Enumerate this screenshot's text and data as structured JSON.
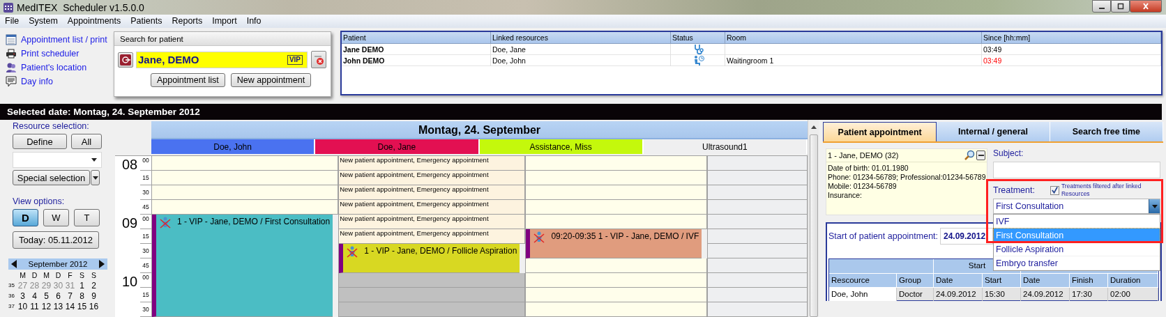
{
  "window": {
    "title": "MedITEX  Scheduler v1.5.0.0"
  },
  "menu": [
    "File",
    "System",
    "Appointments",
    "Patients",
    "Reports",
    "Import",
    "Info"
  ],
  "quick_links": [
    {
      "kind": "list",
      "label": "Appointment list / print"
    },
    {
      "kind": "print",
      "label": "Print scheduler"
    },
    {
      "kind": "location",
      "label": "Patient's location"
    },
    {
      "kind": "info",
      "label": "Day info"
    }
  ],
  "patient_search": {
    "title": "Search for patient",
    "value": "Jane, DEMO",
    "badge": "VIP",
    "buttons": [
      "Appointment list",
      "New appointment"
    ]
  },
  "patients_table": {
    "columns": [
      "Patient",
      "Linked resources",
      "Status",
      "Room",
      "Since [hh:mm]"
    ],
    "rows": [
      {
        "patient": "Jane DEMO",
        "linked_resources": "Doe, Jane",
        "kind": "treatment",
        "since": "03:49",
        "late": false
      },
      {
        "patient": "John DEMO",
        "linked_resources": "Doe, John",
        "kind": "waiting",
        "room": "Waitingroom 1",
        "since": "03:49",
        "late": true
      }
    ]
  },
  "selected_date": "Selected date: Montag, 24. September 2012",
  "sidebar": {
    "resource_label": "Resource selection:",
    "define": "Define",
    "all": "All",
    "special": "Special selection",
    "view_label": "View options:",
    "views": [
      {
        "label": "D",
        "selected": true
      },
      {
        "label": "W",
        "selected": false
      },
      {
        "label": "T",
        "selected": false
      }
    ],
    "today": "Today: 05.11.2012"
  },
  "mini_calendar": {
    "month": "September 2012",
    "weekdays": [
      "M",
      "D",
      "M",
      "D",
      "F",
      "S",
      "S"
    ],
    "weeks": [
      {
        "number": "35",
        "days": [
          {
            "day": "27",
            "other_month": true
          },
          {
            "day": "28",
            "other_month": true
          },
          {
            "day": "29",
            "other_month": true
          },
          {
            "day": "30",
            "other_month": true
          },
          {
            "day": "31",
            "other_month": true
          },
          {
            "day": "1",
            "other_month": false
          },
          {
            "day": "2",
            "other_month": false
          }
        ]
      },
      {
        "number": "36",
        "days": [
          {
            "day": "3",
            "other_month": false
          },
          {
            "day": "4",
            "other_month": false
          },
          {
            "day": "5",
            "other_month": false
          },
          {
            "day": "6",
            "other_month": false
          },
          {
            "day": "7",
            "other_month": false
          },
          {
            "day": "8",
            "other_month": false
          },
          {
            "day": "9",
            "other_month": false
          }
        ]
      },
      {
        "number": "37",
        "days": [
          {
            "day": "10",
            "other_month": false
          },
          {
            "day": "11",
            "other_month": false
          },
          {
            "day": "12",
            "other_month": false
          },
          {
            "day": "13",
            "other_month": false
          },
          {
            "day": "14",
            "other_month": false
          },
          {
            "day": "15",
            "other_month": false
          },
          {
            "day": "16",
            "other_month": false
          }
        ]
      }
    ]
  },
  "schedule": {
    "day": "Montag, 24. September",
    "times": [
      {
        "hour": "08",
        "minute": "00"
      },
      {
        "minute": "15"
      },
      {
        "minute": "30"
      },
      {
        "minute": "45"
      },
      {
        "hour": "09",
        "minute": "00"
      },
      {
        "minute": "15"
      },
      {
        "minute": "30"
      },
      {
        "minute": "45"
      },
      {
        "hour": "10",
        "minute": "00"
      },
      {
        "minute": "15"
      },
      {
        "minute": "30"
      }
    ],
    "resources": [
      {
        "name": "Doe, John",
        "color": "#4a72f0",
        "slots": [
          {
            "kind": "free"
          },
          {
            "kind": "free"
          },
          {
            "kind": "free"
          },
          {
            "kind": "free"
          },
          {
            "kind": "appointment",
            "text": "1 - VIP - Jane, DEMO / First Consultation",
            "color": "#4bbdc4"
          },
          {
            "kind": "continued"
          },
          {
            "kind": "continued"
          },
          {
            "kind": "continued"
          },
          {
            "kind": "continued"
          },
          {
            "kind": "continued"
          },
          {
            "kind": "continued"
          }
        ]
      },
      {
        "name": "Doe, Jane",
        "color": "#e31052",
        "slots": [
          {
            "kind": "note",
            "text": "New patient appointment, Emergency appointment"
          },
          {
            "kind": "note",
            "text": "New patient appointment, Emergency appointment"
          },
          {
            "kind": "note",
            "text": "New patient appointment, Emergency appointment"
          },
          {
            "kind": "note",
            "text": "New patient appointment, Emergency appointment"
          },
          {
            "kind": "note",
            "text": "New patient appointment, Emergency appointment"
          },
          {
            "kind": "note",
            "text": "New patient appointment, Emergency appointment"
          },
          {
            "kind": "appointment",
            "text": "1 - VIP - Jane, DEMO / Follicle Aspiration",
            "color": "#d8d822"
          },
          {
            "kind": "continued"
          },
          {
            "kind": "blocked"
          },
          {
            "kind": "blocked"
          },
          {
            "kind": "blocked"
          }
        ]
      },
      {
        "name": "Assistance, Miss",
        "color": "#c4f80c",
        "slots": [
          {
            "kind": "free"
          },
          {
            "kind": "free"
          },
          {
            "kind": "free"
          },
          {
            "kind": "free"
          },
          {
            "kind": "free"
          },
          {
            "kind": "appointment",
            "text": "09:20-09:35 1 - VIP - Jane, DEMO / IVF",
            "color": "#e09c7e"
          },
          {
            "kind": "continued"
          },
          {
            "kind": "free"
          },
          {
            "kind": "free"
          },
          {
            "kind": "free"
          },
          {
            "kind": "free"
          }
        ]
      },
      {
        "name": "Ultrasound1",
        "color": "#efeff0",
        "slots": [
          {
            "kind": "inactive"
          },
          {
            "kind": "inactive"
          },
          {
            "kind": "inactive"
          },
          {
            "kind": "inactive"
          },
          {
            "kind": "inactive"
          },
          {
            "kind": "inactive"
          },
          {
            "kind": "inactive"
          },
          {
            "kind": "inactive"
          },
          {
            "kind": "inactive"
          },
          {
            "kind": "inactive"
          },
          {
            "kind": "inactive"
          }
        ]
      }
    ]
  },
  "appointment_panel": {
    "tabs": [
      {
        "label": "Patient appointment",
        "selected": true
      },
      {
        "label": "Internal / general",
        "selected": false
      },
      {
        "label": "Search free time",
        "selected": false
      }
    ],
    "patient": {
      "name": "1 - Jane, DEMO (32)",
      "details": [
        "Date of birth: 01.01.1980",
        "Phone: 01234-56789; Professional:01234-56789",
        "Mobile: 01234-56789",
        "Insurance:"
      ]
    },
    "subject": {
      "label": "Subject:"
    },
    "treatment": {
      "label": "Treatment:",
      "highlighted": true,
      "filter": {
        "label": "Treatments filtered after linked Resources",
        "checked": true
      },
      "value": "First Consultation",
      "expanded": true,
      "options": [
        {
          "label": "IVF",
          "selected": false
        },
        {
          "label": "First Consultation",
          "selected": true
        },
        {
          "label": "Follicle Aspiration",
          "selected": false
        },
        {
          "label": "Embryo transfer",
          "selected": false
        }
      ]
    },
    "start": {
      "label": "Start of patient appointment:",
      "value": "24.09.2012"
    },
    "table": {
      "group": "Start",
      "columns": [
        "Rescource",
        "Group",
        "Date",
        "Start",
        "Date",
        "Finish",
        "Duration"
      ],
      "rows": [
        [
          "Doe, John",
          "Doctor",
          "24.09.2012",
          "15:30",
          "24.09.2012",
          "17:30",
          "02:00"
        ]
      ]
    }
  }
}
